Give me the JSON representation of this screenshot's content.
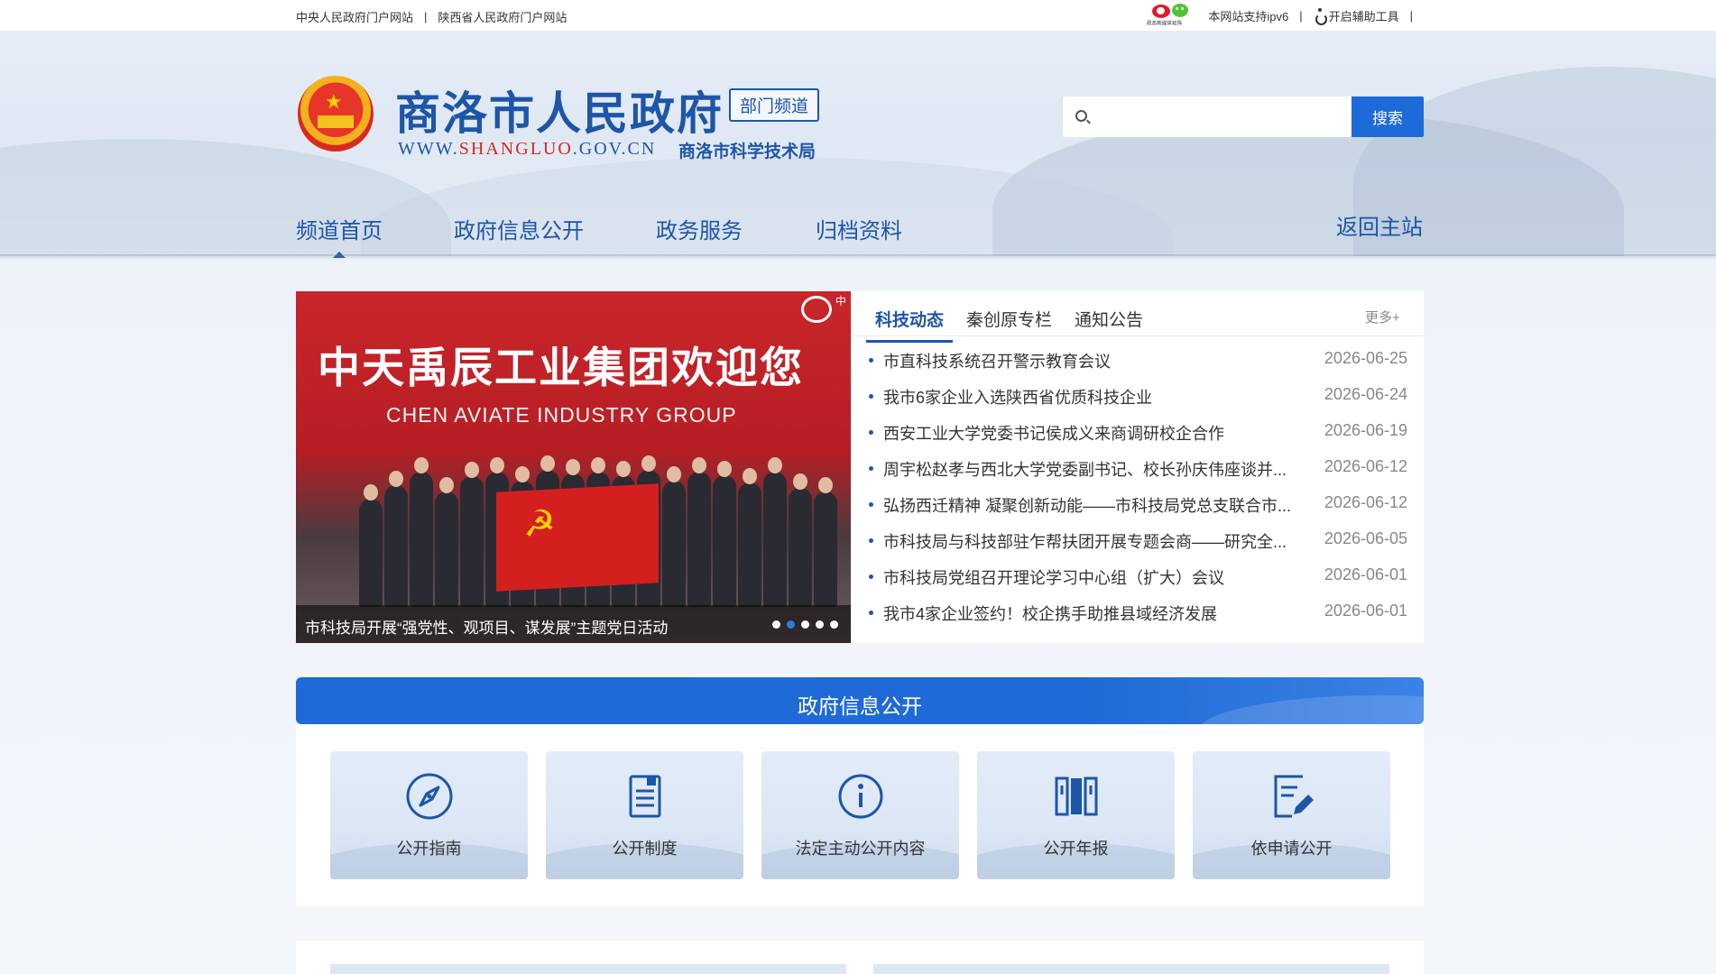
{
  "topbar": {
    "link_central": "中央人民政府门户网站",
    "link_province": "陕西省人民政府门户网站",
    "sep": "|",
    "weibo_caption": "政务新媒体矩阵",
    "ipv6": "本网站支持ipv6",
    "accessibility": "开启辅助工具"
  },
  "header": {
    "title": "商洛市人民政府",
    "badge": "部门频道",
    "url_prefix": "WWW.",
    "url_domain": "SHANGLUO",
    "url_suffix": ".GOV.CN",
    "bureau": "商洛市科学技术局"
  },
  "search": {
    "placeholder": "",
    "button": "搜索"
  },
  "nav": {
    "items": [
      "频道首页",
      "政府信息公开",
      "政务服务",
      "归档资料"
    ],
    "return": "返回主站"
  },
  "slider": {
    "headline": "中天禹辰工业集团欢迎您",
    "subline": "CHEN AVIATE INDUSTRY GROUP",
    "logo_text": "中",
    "caption": "市科技局开展“强党性、观项目、谋发展”主题党日活动",
    "dots": 5,
    "active_dot": 1
  },
  "news": {
    "tabs": [
      "科技动态",
      "秦创原专栏",
      "通知公告"
    ],
    "more": "更多+",
    "items": [
      {
        "title": "市直科技系统召开警示教育会议",
        "date": "2026-06-25"
      },
      {
        "title": "我市6家企业入选陕西省优质科技企业",
        "date": "2026-06-24"
      },
      {
        "title": "西安工业大学党委书记侯成义来商调研校企合作",
        "date": "2026-06-19"
      },
      {
        "title": "周宇松赵孝与西北大学党委副书记、校长孙庆伟座谈并...",
        "date": "2026-06-12"
      },
      {
        "title": "弘扬西迁精神 凝聚创新动能——市科技局党总支联合市...",
        "date": "2026-06-12"
      },
      {
        "title": "市科技局与科技部驻乍帮扶团开展专题会商——研究全...",
        "date": "2026-06-05"
      },
      {
        "title": "市科技局党组召开理论学习中心组（扩大）会议",
        "date": "2026-06-01"
      },
      {
        "title": "我市4家企业签约！校企携手助推县域经济发展",
        "date": "2026-06-01"
      }
    ]
  },
  "section": {
    "title": "政府信息公开"
  },
  "cards": [
    {
      "label": "公开指南",
      "icon": "compass-icon"
    },
    {
      "label": "公开制度",
      "icon": "document-icon"
    },
    {
      "label": "法定主动公开内容",
      "icon": "info-icon"
    },
    {
      "label": "公开年报",
      "icon": "books-icon"
    },
    {
      "label": "依申请公开",
      "icon": "edit-document-icon"
    }
  ],
  "colors": {
    "primary": "#1d56a8",
    "button": "#1e6ad8",
    "accent_red": "#d4281f"
  }
}
